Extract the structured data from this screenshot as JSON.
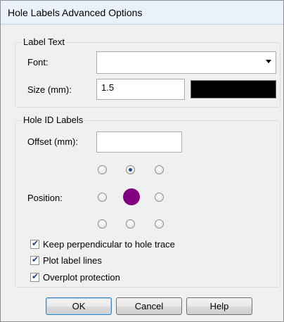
{
  "window": {
    "title": "Hole Labels Advanced Options"
  },
  "label_text": {
    "group_title": "Label Text",
    "font_label": "Font:",
    "font_value": "",
    "size_label": "Size (mm):",
    "size_value": "1.5",
    "color_swatch": "#000000"
  },
  "hole_id_labels": {
    "group_title": "Hole ID Labels",
    "offset_label": "Offset (mm):",
    "offset_value": "",
    "position_label": "Position:",
    "position_selected": "top-center",
    "center_marker_color": "#800080"
  },
  "options": {
    "keep_perpendicular": {
      "label": "Keep perpendicular to hole trace",
      "checked": true
    },
    "plot_label_lines": {
      "label": "Plot label lines",
      "checked": true
    },
    "overplot_protection": {
      "label": "Overplot protection",
      "checked": true
    }
  },
  "buttons": {
    "ok": "OK",
    "cancel": "Cancel",
    "help": "Help"
  }
}
